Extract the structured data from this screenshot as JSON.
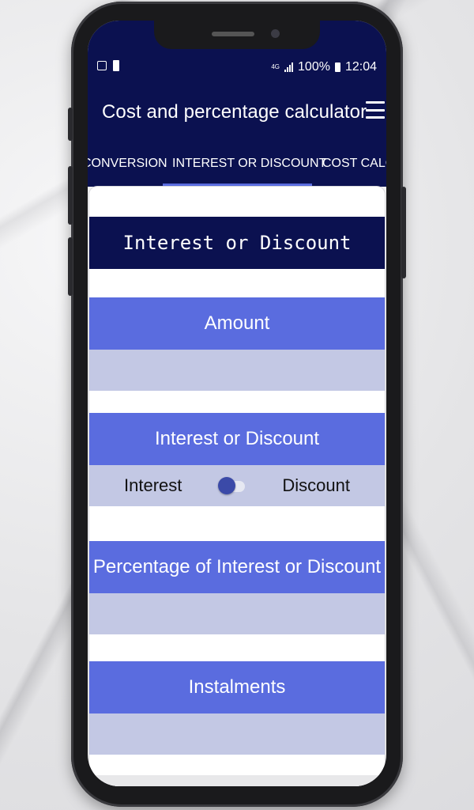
{
  "statusbar": {
    "network": "4G",
    "battery_percent": "100%",
    "time": "12:04"
  },
  "appbar": {
    "title": "Cost and percentage calculator"
  },
  "tabs": [
    {
      "label": "CONVERSION"
    },
    {
      "label": "INTEREST OR DISCOUNT",
      "selected": true
    },
    {
      "label": "COST CALCU"
    }
  ],
  "form": {
    "section_title": "Interest or Discount",
    "amount_label": "Amount",
    "amount_value": "",
    "type_label": "Interest or Discount",
    "toggle_left": "Interest",
    "toggle_right": "Discount",
    "percentage_label": "Percentage of Interest or Discount",
    "percentage_value": "",
    "instalments_label": "Instalments",
    "instalments_value": ""
  },
  "colors": {
    "primary_dark": "#0b1150",
    "accent": "#5a6cdf",
    "field_bg": "#c3c8e4"
  }
}
